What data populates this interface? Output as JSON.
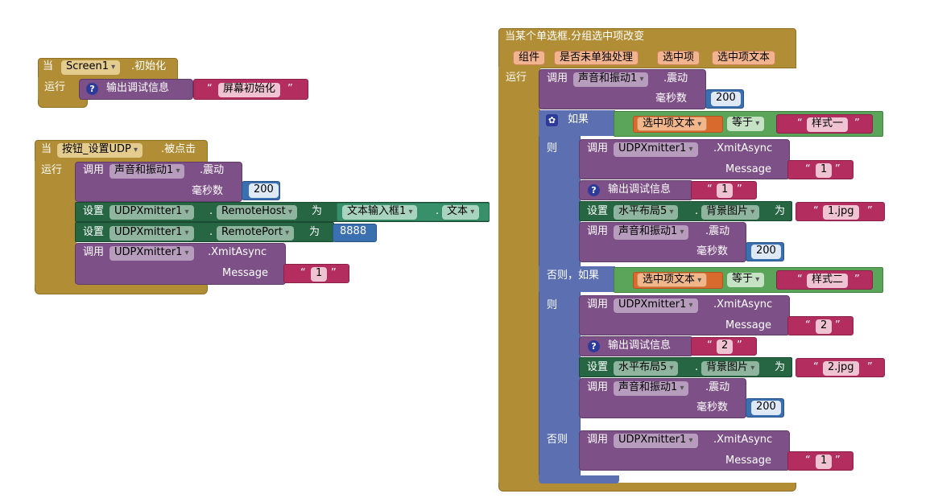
{
  "common": {
    "when": "当",
    "do": "运行",
    "call": "调用",
    "set": "设置",
    "to": "为",
    "dot": ".",
    "if": "如果",
    "then": "则",
    "elseif": "否则，如果",
    "else": "否则",
    "ms": "毫秒数",
    "message": "Message",
    "equals": "等于",
    "debug": "输出调试信息",
    "vibrate": ".震动",
    "xmit": ".XmitAsync",
    "lq": "“",
    "rq": "”"
  },
  "screen_init": {
    "component": "Screen1",
    "event": ".初始化",
    "debug_text": "屏幕初始化"
  },
  "button_click": {
    "component": "按钮_设置UDP",
    "event": ".被点击",
    "sound": "声音和振动1",
    "ms_value": "200",
    "udp": "UDPXmitter1",
    "prop_host": "RemoteHost",
    "textbox": "文本输入框1",
    "textbox_prop": "文本",
    "prop_port": "RemotePort",
    "port_value": "8888",
    "msg_value": "1"
  },
  "radio_change": {
    "event": "当某个单选框.分组选中项改变",
    "params": [
      "组件",
      "是否未单独处理",
      "选中项",
      "选中项文本"
    ],
    "sound": "声音和振动1",
    "ms_value": "200",
    "selected_text": "选中项文本",
    "style1": "样式一",
    "style2": "样式二",
    "udp": "UDPXmitter1",
    "layout": "水平布局5",
    "bg_prop": "背景图片",
    "msg1": "1",
    "msg2": "2",
    "debug1": "1",
    "debug2": "2",
    "img1": "1.jpg",
    "img2": "2.jpg",
    "ms1": "200",
    "ms2": "200",
    "else_msg": "1"
  }
}
